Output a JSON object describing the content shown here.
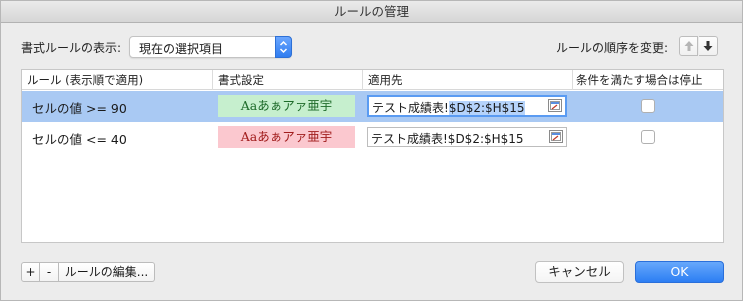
{
  "window": {
    "title": "ルールの管理"
  },
  "toolbar": {
    "show_label": "書式ルールの表示:",
    "show_value": "現在の選択項目",
    "order_label": "ルールの順序を変更:",
    "up_icon": "arrow-up-icon",
    "down_icon": "arrow-down-icon"
  },
  "table": {
    "headers": {
      "rule": "ルール (表示順で適用)",
      "format": "書式設定",
      "apply": "適用先",
      "stop": "条件を満たす場合は停止"
    },
    "rows": [
      {
        "rule": "セルの値 >= 90",
        "format_sample": "Aaあぁアァ亜宇",
        "format_bg": "#c6efce",
        "format_fg": "#1e6b2a",
        "apply_prefix": "テスト成績表!",
        "apply_selected": "$D$2:$H$15",
        "stop": false,
        "selected": true
      },
      {
        "rule": "セルの値 <= 40",
        "format_sample": "Aaあぁアァ亜宇",
        "format_bg": "#fbc8cf",
        "format_fg": "#a11d1d",
        "apply_prefix": "テスト成績表!$D$2:$H$15",
        "apply_selected": "",
        "stop": false,
        "selected": false
      }
    ]
  },
  "footer": {
    "add_label": "+",
    "remove_label": "-",
    "edit_label": "ルールの編集...",
    "cancel_label": "キャンセル",
    "ok_label": "OK"
  },
  "colors": {
    "selection": "#a9c9f3",
    "accent": "#2c7ef3"
  }
}
